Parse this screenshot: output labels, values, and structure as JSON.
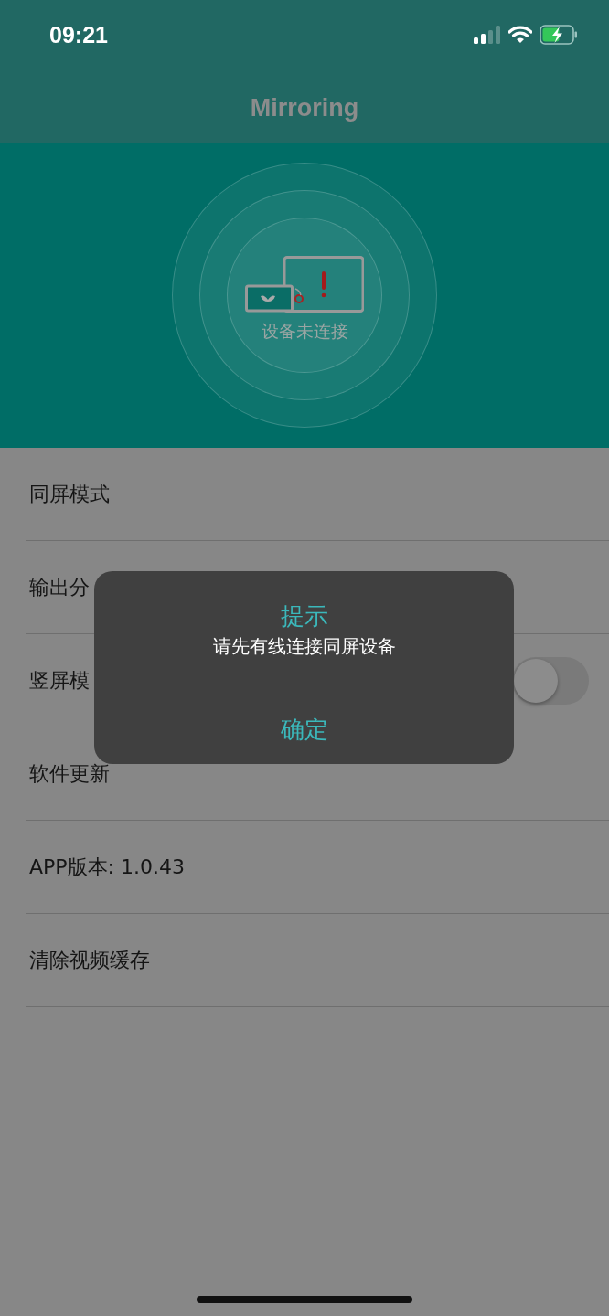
{
  "status_bar": {
    "time": "09:21"
  },
  "nav": {
    "title": "Mirroring"
  },
  "device": {
    "status": "设备未连接",
    "connected": false
  },
  "settings": [
    {
      "kind": "plain",
      "label": "同屏模式"
    },
    {
      "kind": "plain",
      "label": "输出分"
    },
    {
      "kind": "toggle",
      "label": "竖屏模",
      "on": false
    },
    {
      "kind": "plain",
      "label": "软件更新"
    },
    {
      "kind": "plain",
      "label": "APP版本: 1.0.43"
    },
    {
      "kind": "plain",
      "label": "清除视频缓存"
    }
  ],
  "alert": {
    "title": "提示",
    "message": "请先有线连接同屏设备",
    "button": "确定"
  }
}
